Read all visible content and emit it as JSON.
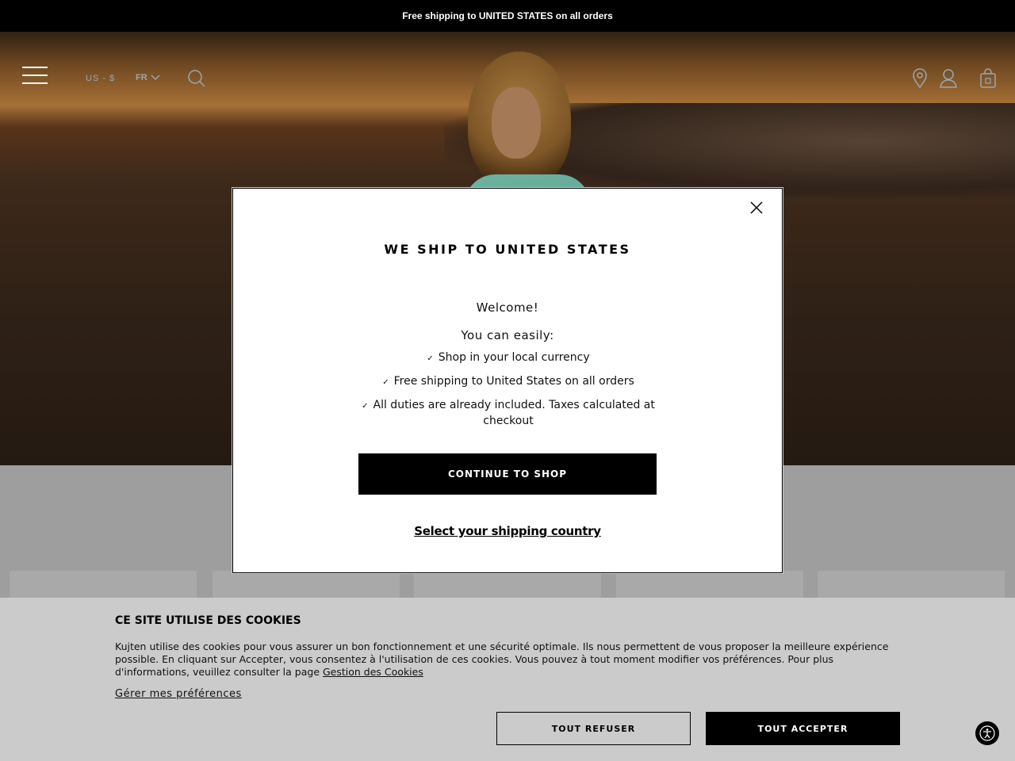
{
  "announcement": "Free shipping to UNITED STATES on all orders",
  "header": {
    "menu_icon": "hamburger-menu-icon",
    "locale": "US - $",
    "language": "FR",
    "icons": [
      "search-icon",
      "location-pin-icon",
      "user-icon",
      "shopping-bag-icon"
    ]
  },
  "modal": {
    "title": "WE SHIP TO UNITED STATES",
    "welcome": "Welcome!",
    "intro": "You can easily:",
    "benefits": [
      "Shop in your local currency",
      "Free shipping to United States on all orders",
      "All duties are already included. Taxes calculated at checkout"
    ],
    "cta": "CONTINUE TO SHOP",
    "select_country": "Select your shipping country"
  },
  "cookies": {
    "title": "CE SITE UTILISE DES COOKIES",
    "text": "Kujten utilise des cookies pour vous assurer un bon fonctionnement et une sécurité optimale. Ils nous permettent de vous proposer la meilleure expérience possible. En cliquant sur Accepter, vous consentez à l'utilisation de ces cookies. Vous pouvez à tout moment modifier vos préférences. Pour plus d'informations, veuillez consulter la page",
    "link": "Gestion des Cookies",
    "preferences": "Gérer mes préférences",
    "refuse": "TOUT REFUSER",
    "accept": "TOUT ACCEPTER"
  },
  "colors": {
    "background_bar": "#000000",
    "cookie_bg": "#cbcbcb",
    "accent": "#000000"
  }
}
